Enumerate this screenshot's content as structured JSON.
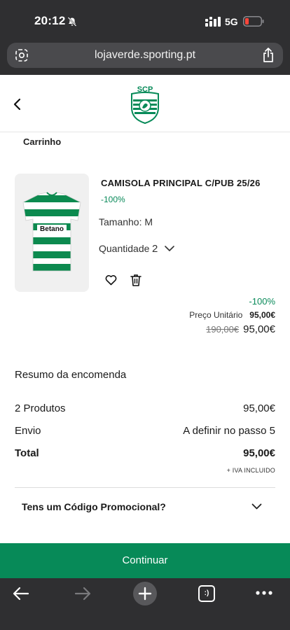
{
  "status": {
    "time": "20:12",
    "network": "5G"
  },
  "browser": {
    "url": "lojaverde.sporting.pt"
  },
  "header": {
    "logo_text": "SCP"
  },
  "breadcrumb": "Carrinho",
  "product": {
    "name": "CAMISOLA PRINCIPAL C/PUB 25/26",
    "discount": "-100%",
    "size": "Tamanho: M",
    "quantity_label": "Quantidade",
    "quantity_value": "2",
    "discount_right": "-100%",
    "unit_price_label": "Preço Unitário",
    "unit_price_value": "95,00€",
    "old_price": "190,00€",
    "new_price": "95,00€"
  },
  "summary": {
    "title": "Resumo da encomenda",
    "products_label": "2 Produtos",
    "products_value": "95,00€",
    "shipping_label": "Envio",
    "shipping_value": "A definir no passo 5",
    "total_label": "Total",
    "total_value": "95,00€",
    "tax_note": "+ IVA INCLUIDO"
  },
  "promo": {
    "label": "Tens um Código Promocional?"
  },
  "cta": {
    "continue_label": "Continuar"
  },
  "toolbar": {
    "tabs_label": ":)"
  },
  "colors": {
    "brand_green": "#078a58",
    "discount_green": "#0a8a5a",
    "chrome_dark": "#2f2f31"
  }
}
